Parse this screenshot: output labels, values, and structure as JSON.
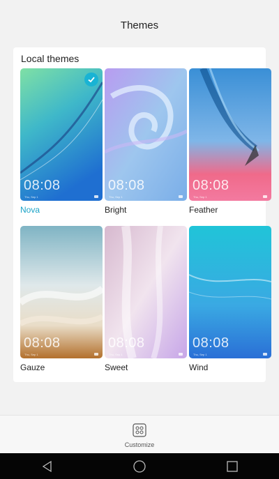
{
  "header": {
    "title": "Themes"
  },
  "local_themes": {
    "section_title": "Local themes",
    "items": [
      {
        "name": "Nova",
        "clock": "08:08",
        "date": "Thu, Sep 1",
        "selected": true
      },
      {
        "name": "Bright",
        "clock": "08:08",
        "date": "Thu, Sep 1",
        "selected": false
      },
      {
        "name": "Feather",
        "clock": "08:08",
        "date": "Thu, Sep 1",
        "selected": false
      },
      {
        "name": "Gauze",
        "clock": "08:08",
        "date": "Thu, Sep 1",
        "selected": false
      },
      {
        "name": "Sweet",
        "clock": "08:08",
        "date": "Thu, Sep 1",
        "selected": false
      },
      {
        "name": "Wind",
        "clock": "08:08",
        "date": "Thu, Sep 1",
        "selected": false
      }
    ]
  },
  "bottom_bar": {
    "customize_label": "Customize",
    "icon": "customize-icon"
  },
  "nav": {
    "icons": [
      "back-icon",
      "home-icon",
      "recents-icon"
    ]
  },
  "colors": {
    "accent": "#1aa3c7",
    "check_badge": "#19b3d4"
  }
}
